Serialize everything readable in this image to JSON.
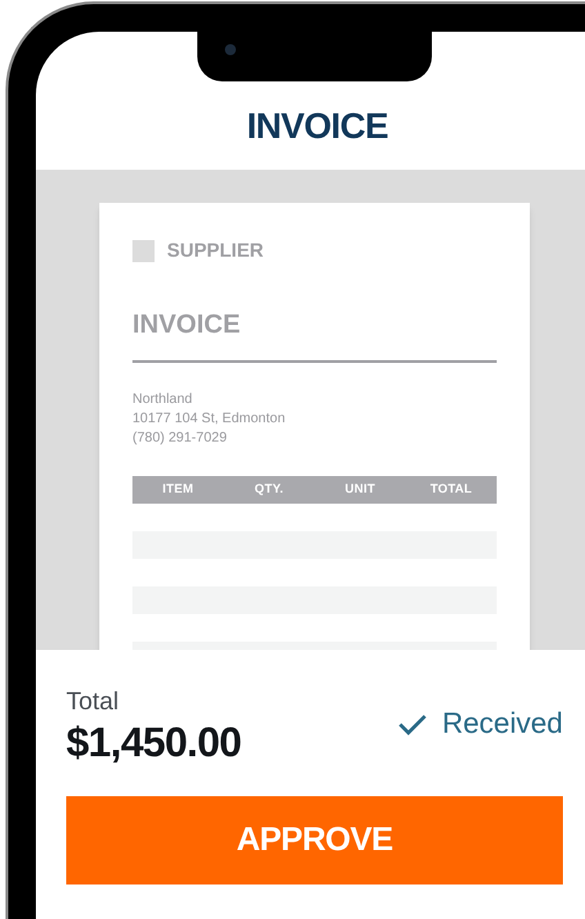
{
  "header": {
    "title": "INVOICE"
  },
  "document": {
    "supplier": "SUPPLIER",
    "title": "INVOICE",
    "address": [
      "Northland",
      "10177 104 St, Edmonton",
      "(780) 291-7029"
    ],
    "columns": [
      "ITEM",
      "QTY.",
      "UNIT",
      "TOTAL"
    ]
  },
  "summary": {
    "total_label": "Total",
    "total": "$1,450.00",
    "status": {
      "label": "Received",
      "checked": true
    }
  },
  "buttons": [
    {
      "label": "APPROVE"
    }
  ]
}
